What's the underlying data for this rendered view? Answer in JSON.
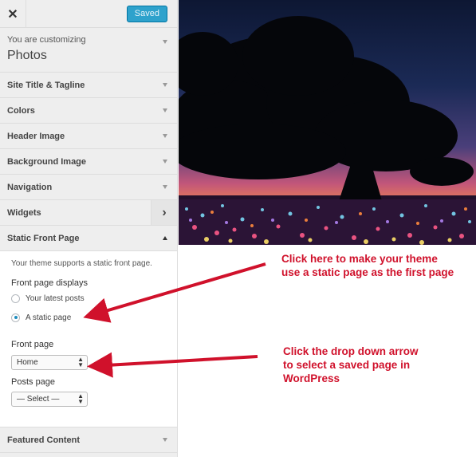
{
  "topbar": {
    "close_symbol": "✕",
    "saved_label": "Saved"
  },
  "customizing": {
    "prefix": "You are customizing",
    "theme_name": "Photos"
  },
  "sections": {
    "site_title": "Site Title & Tagline",
    "colors": "Colors",
    "header_image": "Header Image",
    "background_image": "Background Image",
    "navigation": "Navigation",
    "widgets": "Widgets",
    "static_front_page": "Static Front Page",
    "featured_content": "Featured Content"
  },
  "static_panel": {
    "description": "Your theme supports a static front page.",
    "front_page_displays_label": "Front page displays",
    "option_latest": "Your latest posts",
    "option_static": "A static page",
    "selected_option": "A static page",
    "front_page_label": "Front page",
    "front_page_value": "Home",
    "posts_page_label": "Posts page",
    "posts_page_value": "— Select —"
  },
  "annotations": {
    "note1_line1": "Click here to make your theme",
    "note1_line2": "use a static page as the first page",
    "note2_line1": "Click the drop down arrow",
    "note2_line2": "to select a saved page in",
    "note2_line3": "WordPress"
  },
  "colors": {
    "accent_blue": "#2ea2cc",
    "annotation_red": "#d0112b"
  }
}
